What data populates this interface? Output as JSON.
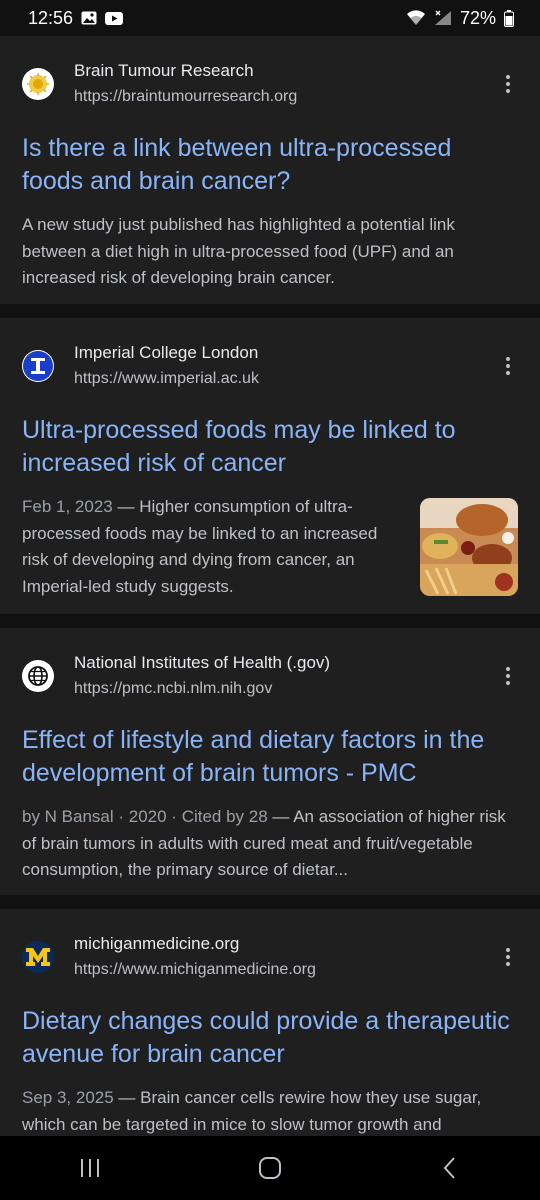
{
  "status_bar": {
    "time": "12:56",
    "battery": "72%",
    "icons": [
      "gallery-icon",
      "youtube-icon",
      "wifi-icon",
      "signal-icon",
      "battery-icon"
    ]
  },
  "results": [
    {
      "favicon": "brain-tumour-research-logo",
      "source_name": "Brain Tumour Research",
      "url": "https://braintumourresearch.org",
      "title": "Is there a link between ultra-processed foods and brain cancer?",
      "snippet": "A new study just published has highlighted a potential link between a diet high in ultra-processed food (UPF) and an increased risk of developing brain cancer."
    },
    {
      "favicon": "imperial-college-logo",
      "source_name": "Imperial College London",
      "url": "https://www.imperial.ac.uk",
      "title": "Ultra-processed foods may be linked to increased risk of cancer",
      "date": "Feb 1, 2023",
      "snippet": "Higher consumption of ultra-processed foods may be linked to an increased risk of developing and dying from cancer, an Imperial-led study suggests.",
      "has_thumbnail": true
    },
    {
      "favicon": "globe-icon",
      "source_name": "National Institutes of Health (.gov)",
      "url": "https://pmc.ncbi.nlm.nih.gov",
      "title": "Effect of lifestyle and dietary factors in the development of brain tumors - PMC",
      "meta": "by N Bansal · 2020 · Cited by 28",
      "snippet": "An association of higher risk of brain tumors in adults with cured meat and fruit/vegetable consumption, the primary source of dietar..."
    },
    {
      "favicon": "michigan-m-logo",
      "source_name": "michiganmedicine.org",
      "url": "https://www.michiganmedicine.org",
      "title": "Dietary changes could provide a therapeutic avenue for brain cancer",
      "date": "Sep 3, 2025",
      "snippet": "Brain cancer cells rewire how they use sugar, which can be targeted in mice to slow tumor growth and"
    }
  ],
  "separator": " — ",
  "nav_bar": {
    "buttons": [
      "recents-icon",
      "home-icon",
      "back-icon"
    ]
  },
  "colors": {
    "background": "#111111",
    "card": "#1f1f1f",
    "link": "#8ab4f8",
    "text": "#bdc1c6"
  }
}
